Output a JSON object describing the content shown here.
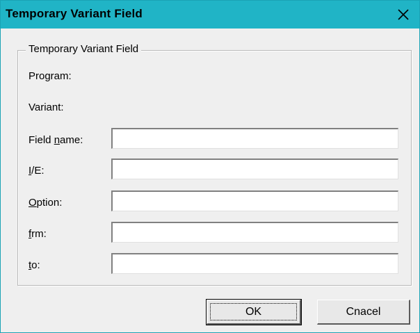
{
  "window": {
    "title": "Temporary Variant Field"
  },
  "group": {
    "title": "Temporary Variant Field"
  },
  "info": {
    "program_label": "Program:",
    "variant_label": "Variant:"
  },
  "fields": {
    "field_name": {
      "label_pre": "Field ",
      "label_key": "n",
      "label_post": "ame:",
      "value": ""
    },
    "ie": {
      "label_pre": "",
      "label_key": "I",
      "label_post": "/E:",
      "value": ""
    },
    "option": {
      "label_pre": "",
      "label_key": "O",
      "label_post": "ption:",
      "value": ""
    },
    "frm": {
      "label_pre": "",
      "label_key": "f",
      "label_post": "rm:",
      "value": ""
    },
    "to": {
      "label_pre": "",
      "label_key": "t",
      "label_post": "o:",
      "value": ""
    }
  },
  "buttons": {
    "ok_label": "OK",
    "cancel_label": "Cnacel"
  },
  "icons": {
    "close": "close-icon"
  },
  "colors": {
    "titlebar": "#20b4c6",
    "dialog_bg": "#efefef"
  }
}
